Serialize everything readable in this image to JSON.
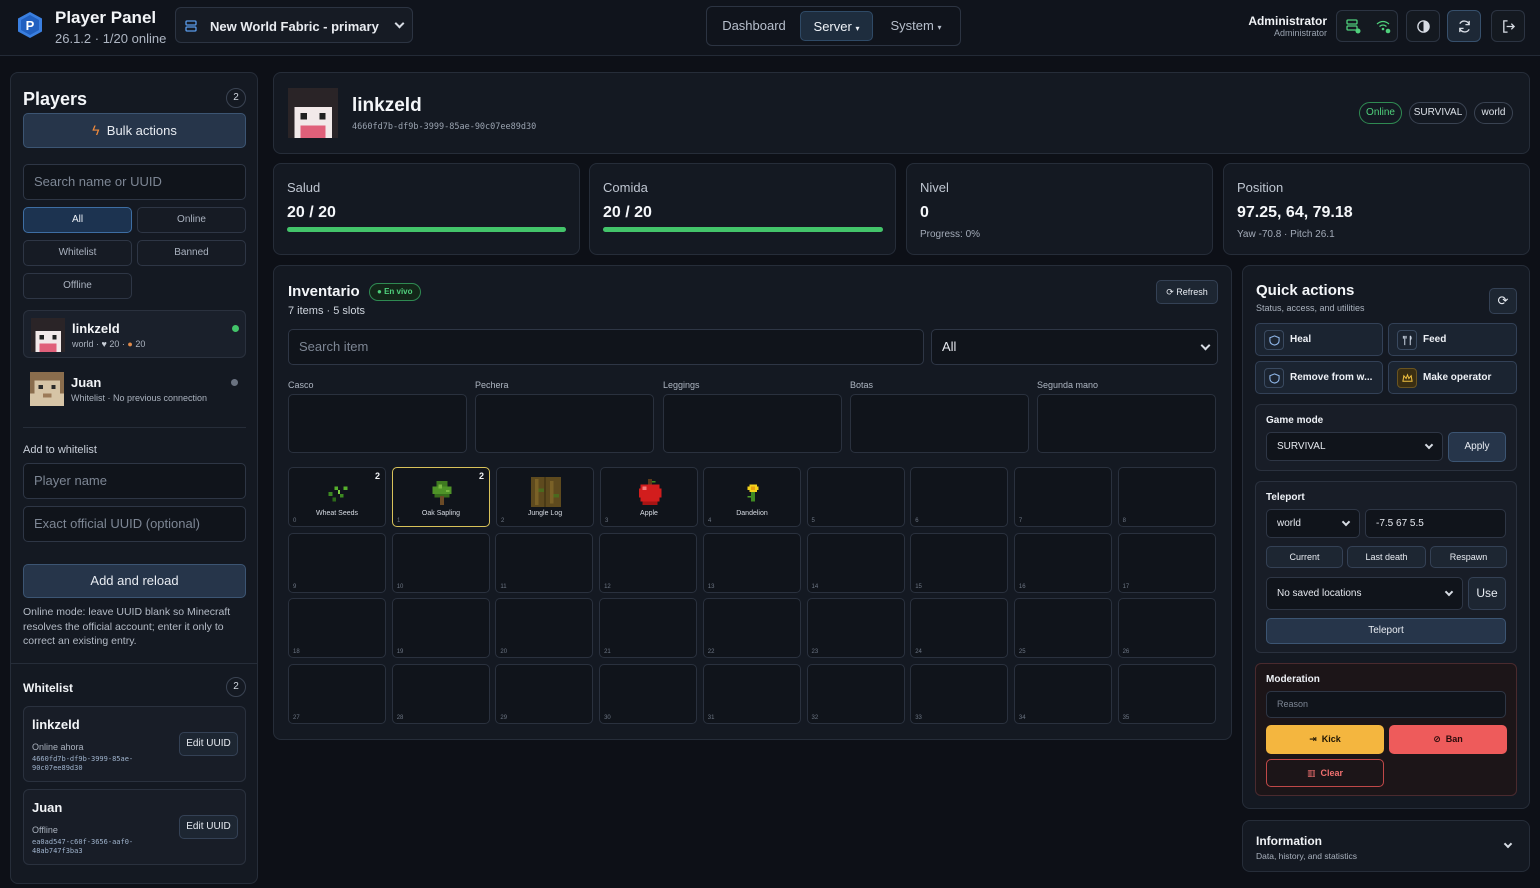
{
  "header": {
    "brand_title": "Player Panel",
    "brand_sub": "26.1.2 · 1/20 online",
    "server_name": "New World Fabric - primary",
    "nav": [
      {
        "label": "Dashboard",
        "caret": ""
      },
      {
        "label": "Server",
        "caret": "▾"
      },
      {
        "label": "System",
        "caret": "▾"
      }
    ],
    "user_name": "Administrator",
    "user_role": "Administrator"
  },
  "sidebar": {
    "title": "Players",
    "count": "2",
    "bulk_label": "Bulk actions",
    "search_placeholder": "Search name or UUID",
    "filters": [
      "All",
      "Online",
      "Whitelist",
      "Banned",
      "Offline"
    ],
    "players": [
      {
        "name": "linkzeld",
        "world": "world",
        "health": "20",
        "food": "20",
        "online": true
      },
      {
        "name": "Juan",
        "detail": "Whitelist · No previous connection",
        "online": false
      }
    ],
    "add_whitelist_label": "Add to whitelist",
    "player_name_placeholder": "Player name",
    "uuid_placeholder": "Exact official UUID (optional)",
    "add_button": "Add and reload",
    "hint": "Online mode: leave UUID blank so Minecraft resolves the official account; enter it only to correct an existing entry.",
    "whitelist_title": "Whitelist",
    "whitelist_count": "2",
    "whitelist": [
      {
        "name": "linkzeld",
        "status": "Online ahora",
        "uuid_1": "4660fd7b-df9b-3999-85ae-",
        "uuid_2": "90c07ee89d30",
        "edit_label": "Edit UUID"
      },
      {
        "name": "Juan",
        "status": "Offline",
        "uuid_1": "ea0ad547-c60f-3656-aaf0-",
        "uuid_2": "48ab747f3ba3",
        "edit_label": "Edit UUID"
      }
    ]
  },
  "player": {
    "name": "linkzeld",
    "uuid": "4660fd7b-df9b-3999-85ae-90c07ee89d30",
    "badges": [
      "Online",
      "SURVIVAL",
      "world"
    ]
  },
  "stats": [
    {
      "title": "Salud",
      "value": "20 / 20",
      "bar": 1.0
    },
    {
      "title": "Comida",
      "value": "20 / 20",
      "bar": 1.0
    },
    {
      "title": "Nivel",
      "value": "0",
      "note": "Progress: 0%"
    },
    {
      "title": "Position",
      "value": "97.25, 64, 79.18",
      "note": "Yaw -70.8 · Pitch 26.1"
    }
  ],
  "inventory": {
    "title": "Inventario",
    "live_label": "En vivo",
    "summary": "7 items · 5 slots",
    "refresh_label": "Refresh",
    "search_placeholder": "Search item",
    "filter_value": "All",
    "armor_labels": [
      "Casco",
      "Pechera",
      "Leggings",
      "Botas",
      "Segunda mano"
    ],
    "slots": [
      {
        "index": "0",
        "name": "Wheat Seeds",
        "qty": "2",
        "icon": "wheat-seeds-icon"
      },
      {
        "index": "1",
        "name": "Oak Sapling",
        "qty": "2",
        "icon": "oak-sapling-icon",
        "selected": true
      },
      {
        "index": "2",
        "name": "Jungle Log",
        "qty": "",
        "icon": "jungle-log-icon"
      },
      {
        "index": "3",
        "name": "Apple",
        "qty": "",
        "icon": "apple-icon"
      },
      {
        "index": "4",
        "name": "Dandelion",
        "qty": "",
        "icon": "dandelion-icon"
      }
    ],
    "empty_from": 5,
    "empty_to": 35
  },
  "quick_actions": {
    "title": "Quick actions",
    "subtitle": "Status, access, and utilities",
    "heal": "Heal",
    "feed": "Feed",
    "remove": "Remove from w...",
    "operator": "Make operator",
    "game_mode_label": "Game mode",
    "game_mode_value": "SURVIVAL",
    "apply": "Apply",
    "teleport_label": "Teleport",
    "tp_world": "world",
    "tp_coords": "-7.5 67 5.5",
    "current": "Current",
    "last_death": "Last death",
    "respawn": "Respawn",
    "saved_locations": "No saved locations",
    "use": "Use",
    "teleport_btn": "Teleport",
    "moderation_label": "Moderation",
    "reason_placeholder": "Reason",
    "kick": "Kick",
    "ban": "Ban",
    "clear": "Clear"
  },
  "information": {
    "title": "Information",
    "subtitle": "Data, history, and statistics"
  },
  "colors": {
    "accent_green": "#43c46a",
    "kick": "#f4b63f",
    "ban": "#ee5b5b",
    "clear_border": "#c04848"
  }
}
